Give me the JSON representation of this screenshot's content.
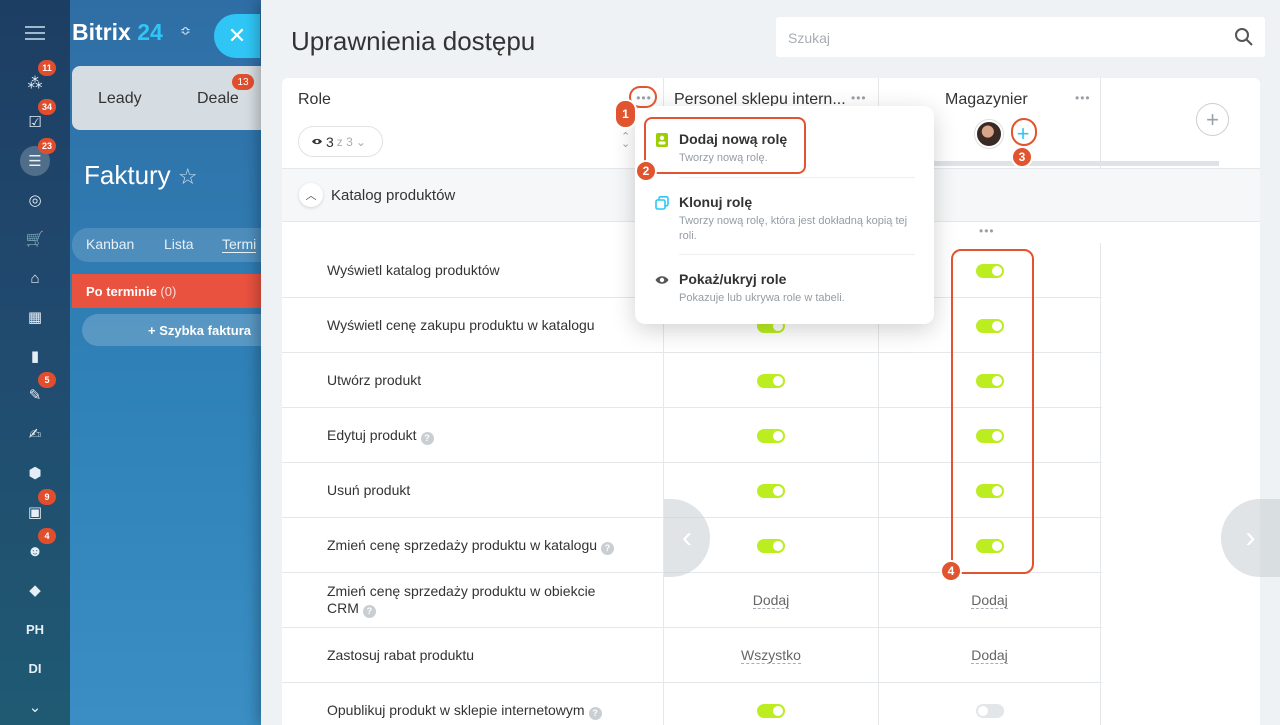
{
  "sidebar": {
    "items": [
      {
        "icon": "network-icon",
        "badge": "11"
      },
      {
        "icon": "tasks-check-icon",
        "badge": "34"
      },
      {
        "icon": "crm-funnel-icon",
        "badge": "23",
        "active": true
      },
      {
        "icon": "target-icon",
        "badge": ""
      },
      {
        "icon": "cart-icon",
        "badge": ""
      },
      {
        "icon": "bank-icon",
        "badge": ""
      },
      {
        "icon": "calendar-icon",
        "badge": ""
      },
      {
        "icon": "bar-chart-icon",
        "badge": ""
      },
      {
        "icon": "document-edit-icon",
        "badge": "5"
      },
      {
        "icon": "signature-icon",
        "badge": ""
      },
      {
        "icon": "shield-icon",
        "badge": ""
      },
      {
        "icon": "contact-card-icon",
        "badge": "9"
      },
      {
        "icon": "robot-icon",
        "badge": "4"
      },
      {
        "icon": "box-icon",
        "badge": ""
      },
      {
        "text": "PH"
      },
      {
        "text": "DI"
      },
      {
        "icon": "chevron-down-icon",
        "badge": ""
      }
    ]
  },
  "background": {
    "logo_main": "Bitrix",
    "logo_num": "24",
    "tabs": [
      {
        "label": "Leady"
      },
      {
        "label": "Deale"
      }
    ],
    "deals_badge": "13",
    "page_title": "Faktury",
    "star": "☆",
    "subtabs": [
      "Kanban",
      "Lista",
      "Termi"
    ],
    "overdue_label": "Po terminie",
    "overdue_count": "(0)",
    "quick_label": "Szybka faktura"
  },
  "slider": {
    "title": "Uprawnienia dostępu",
    "search_placeholder": "Szukaj"
  },
  "table": {
    "role_label": "Role",
    "counter_visible": "3",
    "counter_total": "z 3",
    "columns": [
      {
        "title": "Personel sklepu intern..."
      },
      {
        "title": "Magazynier"
      }
    ],
    "section_label": "Katalog produktów",
    "rows": [
      {
        "name": "Wyświetl katalog produktów",
        "help": false,
        "c1": "on",
        "c2": "on"
      },
      {
        "name": "Wyświetl cenę zakupu produktu w katalogu",
        "help": false,
        "c1": "on",
        "c2": "on"
      },
      {
        "name": "Utwórz produkt",
        "help": false,
        "c1": "on",
        "c2": "on"
      },
      {
        "name": "Edytuj produkt",
        "help": true,
        "c1": "on",
        "c2": "on"
      },
      {
        "name": "Usuń produkt",
        "help": false,
        "c1": "on",
        "c2": "on"
      },
      {
        "name": "Zmień cenę sprzedaży produktu w katalogu",
        "help": true,
        "c1": "on",
        "c2": "on"
      },
      {
        "name": "Zmień cenę sprzedaży produktu w obiekcie CRM",
        "help": true,
        "c1": "Dodaj",
        "c2": "Dodaj"
      },
      {
        "name": "Zastosuj rabat produktu",
        "help": false,
        "c1": "Wszystko",
        "c2": "Dodaj"
      },
      {
        "name": "Opublikuj produkt w sklepie internetowym",
        "help": true,
        "c1": "on",
        "c2": "off"
      }
    ]
  },
  "dropdown": {
    "items": [
      {
        "title": "Dodaj nową rolę",
        "desc": "Tworzy nową rolę.",
        "icon": "add-role-icon"
      },
      {
        "title": "Klonuj rolę",
        "desc": "Tworzy nową rolę, która jest dokładną kopią tej roli.",
        "icon": "clone-icon"
      },
      {
        "title": "Pokaż/ukryj role",
        "desc": "Pokazuje lub ukrywa role w tabeli.",
        "icon": "eye-icon"
      }
    ]
  },
  "markers": [
    "1",
    "2",
    "3",
    "4"
  ],
  "colors": {
    "accent": "#2fc6f6",
    "toggle_on": "#bbed21",
    "annotation": "#e0542f"
  }
}
